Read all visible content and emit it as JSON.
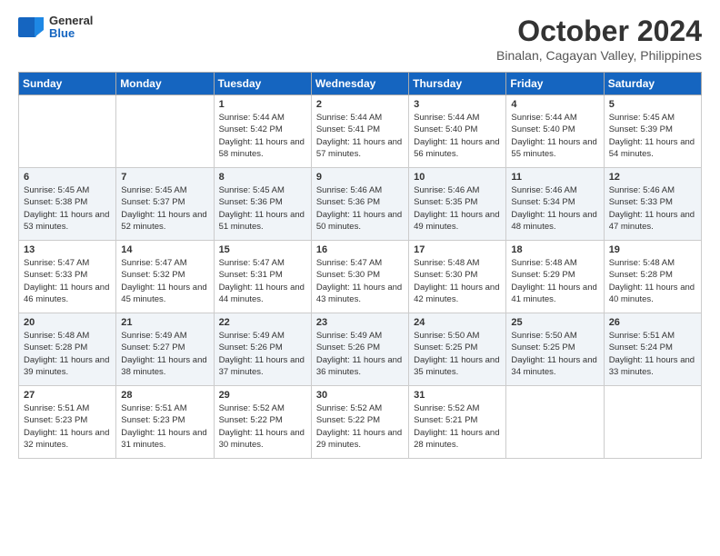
{
  "logo": {
    "general": "General",
    "blue": "Blue",
    "tagline": ""
  },
  "header": {
    "month_title": "October 2024",
    "subtitle": "Binalan, Cagayan Valley, Philippines"
  },
  "weekdays": [
    "Sunday",
    "Monday",
    "Tuesday",
    "Wednesday",
    "Thursday",
    "Friday",
    "Saturday"
  ],
  "weeks": [
    [
      {
        "day": "",
        "info": ""
      },
      {
        "day": "",
        "info": ""
      },
      {
        "day": "1",
        "info": "Sunrise: 5:44 AM\nSunset: 5:42 PM\nDaylight: 11 hours and 58 minutes."
      },
      {
        "day": "2",
        "info": "Sunrise: 5:44 AM\nSunset: 5:41 PM\nDaylight: 11 hours and 57 minutes."
      },
      {
        "day": "3",
        "info": "Sunrise: 5:44 AM\nSunset: 5:40 PM\nDaylight: 11 hours and 56 minutes."
      },
      {
        "day": "4",
        "info": "Sunrise: 5:44 AM\nSunset: 5:40 PM\nDaylight: 11 hours and 55 minutes."
      },
      {
        "day": "5",
        "info": "Sunrise: 5:45 AM\nSunset: 5:39 PM\nDaylight: 11 hours and 54 minutes."
      }
    ],
    [
      {
        "day": "6",
        "info": "Sunrise: 5:45 AM\nSunset: 5:38 PM\nDaylight: 11 hours and 53 minutes."
      },
      {
        "day": "7",
        "info": "Sunrise: 5:45 AM\nSunset: 5:37 PM\nDaylight: 11 hours and 52 minutes."
      },
      {
        "day": "8",
        "info": "Sunrise: 5:45 AM\nSunset: 5:36 PM\nDaylight: 11 hours and 51 minutes."
      },
      {
        "day": "9",
        "info": "Sunrise: 5:46 AM\nSunset: 5:36 PM\nDaylight: 11 hours and 50 minutes."
      },
      {
        "day": "10",
        "info": "Sunrise: 5:46 AM\nSunset: 5:35 PM\nDaylight: 11 hours and 49 minutes."
      },
      {
        "day": "11",
        "info": "Sunrise: 5:46 AM\nSunset: 5:34 PM\nDaylight: 11 hours and 48 minutes."
      },
      {
        "day": "12",
        "info": "Sunrise: 5:46 AM\nSunset: 5:33 PM\nDaylight: 11 hours and 47 minutes."
      }
    ],
    [
      {
        "day": "13",
        "info": "Sunrise: 5:47 AM\nSunset: 5:33 PM\nDaylight: 11 hours and 46 minutes."
      },
      {
        "day": "14",
        "info": "Sunrise: 5:47 AM\nSunset: 5:32 PM\nDaylight: 11 hours and 45 minutes."
      },
      {
        "day": "15",
        "info": "Sunrise: 5:47 AM\nSunset: 5:31 PM\nDaylight: 11 hours and 44 minutes."
      },
      {
        "day": "16",
        "info": "Sunrise: 5:47 AM\nSunset: 5:30 PM\nDaylight: 11 hours and 43 minutes."
      },
      {
        "day": "17",
        "info": "Sunrise: 5:48 AM\nSunset: 5:30 PM\nDaylight: 11 hours and 42 minutes."
      },
      {
        "day": "18",
        "info": "Sunrise: 5:48 AM\nSunset: 5:29 PM\nDaylight: 11 hours and 41 minutes."
      },
      {
        "day": "19",
        "info": "Sunrise: 5:48 AM\nSunset: 5:28 PM\nDaylight: 11 hours and 40 minutes."
      }
    ],
    [
      {
        "day": "20",
        "info": "Sunrise: 5:48 AM\nSunset: 5:28 PM\nDaylight: 11 hours and 39 minutes."
      },
      {
        "day": "21",
        "info": "Sunrise: 5:49 AM\nSunset: 5:27 PM\nDaylight: 11 hours and 38 minutes."
      },
      {
        "day": "22",
        "info": "Sunrise: 5:49 AM\nSunset: 5:26 PM\nDaylight: 11 hours and 37 minutes."
      },
      {
        "day": "23",
        "info": "Sunrise: 5:49 AM\nSunset: 5:26 PM\nDaylight: 11 hours and 36 minutes."
      },
      {
        "day": "24",
        "info": "Sunrise: 5:50 AM\nSunset: 5:25 PM\nDaylight: 11 hours and 35 minutes."
      },
      {
        "day": "25",
        "info": "Sunrise: 5:50 AM\nSunset: 5:25 PM\nDaylight: 11 hours and 34 minutes."
      },
      {
        "day": "26",
        "info": "Sunrise: 5:51 AM\nSunset: 5:24 PM\nDaylight: 11 hours and 33 minutes."
      }
    ],
    [
      {
        "day": "27",
        "info": "Sunrise: 5:51 AM\nSunset: 5:23 PM\nDaylight: 11 hours and 32 minutes."
      },
      {
        "day": "28",
        "info": "Sunrise: 5:51 AM\nSunset: 5:23 PM\nDaylight: 11 hours and 31 minutes."
      },
      {
        "day": "29",
        "info": "Sunrise: 5:52 AM\nSunset: 5:22 PM\nDaylight: 11 hours and 30 minutes."
      },
      {
        "day": "30",
        "info": "Sunrise: 5:52 AM\nSunset: 5:22 PM\nDaylight: 11 hours and 29 minutes."
      },
      {
        "day": "31",
        "info": "Sunrise: 5:52 AM\nSunset: 5:21 PM\nDaylight: 11 hours and 28 minutes."
      },
      {
        "day": "",
        "info": ""
      },
      {
        "day": "",
        "info": ""
      }
    ]
  ]
}
